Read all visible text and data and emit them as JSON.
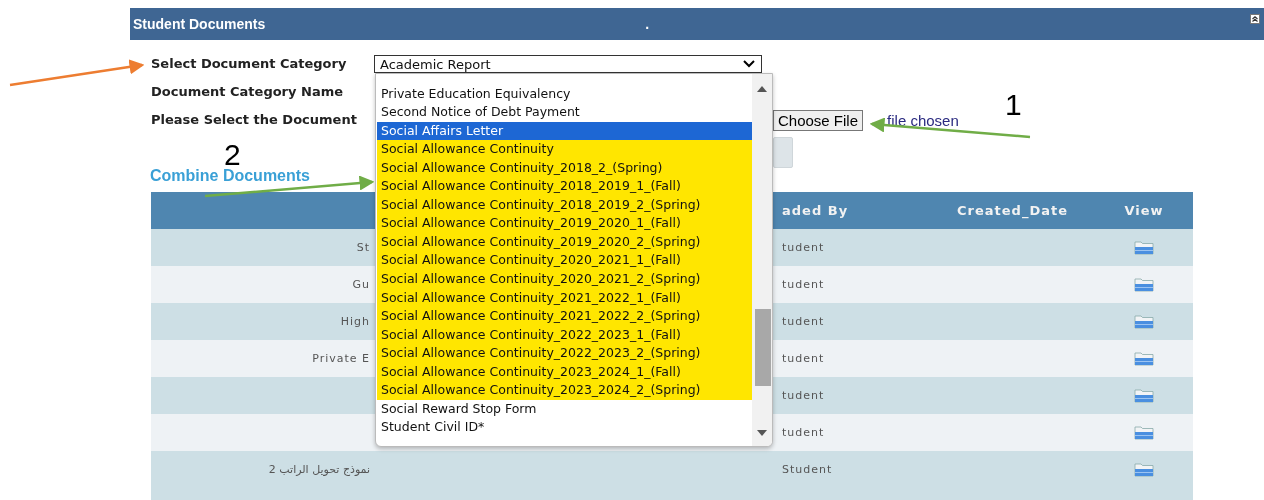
{
  "header": {
    "title": "Student Documents",
    "marker": "."
  },
  "form": {
    "category_label": "Select Document Category",
    "category_value": "Academic Report",
    "name_label": "Document Category Name",
    "document_label": "Please Select the Document",
    "file_button": "Choose File",
    "file_status": "file chosen"
  },
  "dropdown": {
    "options": [
      {
        "label": "Private Education Equivalency",
        "selected": false,
        "highlighted": false
      },
      {
        "label": "Second Notice of Debt Payment",
        "selected": false,
        "highlighted": false
      },
      {
        "label": "Social Affairs Letter",
        "selected": true,
        "highlighted": false
      },
      {
        "label": "Social Allowance Continuity",
        "selected": false,
        "highlighted": true
      },
      {
        "label": "Social Allowance Continuity_2018_2_(Spring)",
        "selected": false,
        "highlighted": true
      },
      {
        "label": "Social Allowance Continuity_2018_2019_1_(Fall)",
        "selected": false,
        "highlighted": true
      },
      {
        "label": "Social Allowance Continuity_2018_2019_2_(Spring)",
        "selected": false,
        "highlighted": true
      },
      {
        "label": "Social Allowance Continuity_2019_2020_1_(Fall)",
        "selected": false,
        "highlighted": true
      },
      {
        "label": "Social Allowance Continuity_2019_2020_2_(Spring)",
        "selected": false,
        "highlighted": true
      },
      {
        "label": "Social Allowance Continuity_2020_2021_1_(Fall)",
        "selected": false,
        "highlighted": true
      },
      {
        "label": "Social Allowance Continuity_2020_2021_2_(Spring)",
        "selected": false,
        "highlighted": true
      },
      {
        "label": "Social Allowance Continuity_2021_2022_1_(Fall)",
        "selected": false,
        "highlighted": true
      },
      {
        "label": "Social Allowance Continuity_2021_2022_2_(Spring)",
        "selected": false,
        "highlighted": true
      },
      {
        "label": "Social Allowance Continuity_2022_2023_1_(Fall)",
        "selected": false,
        "highlighted": true
      },
      {
        "label": "Social Allowance Continuity_2022_2023_2_(Spring)",
        "selected": false,
        "highlighted": true
      },
      {
        "label": "Social Allowance Continuity_2023_2024_1_(Fall)",
        "selected": false,
        "highlighted": true
      },
      {
        "label": "Social Allowance Continuity_2023_2024_2_(Spring)",
        "selected": false,
        "highlighted": true
      },
      {
        "label": "Social Reward Stop Form",
        "selected": false,
        "highlighted": false
      },
      {
        "label": "Student Civil ID*",
        "selected": false,
        "highlighted": false
      }
    ]
  },
  "combine_title": "Combine Documents",
  "table": {
    "columns": [
      "aded By",
      "Created_Date",
      "View"
    ],
    "rows": [
      {
        "column_1": "St",
        "uploaded_by": "tudent"
      },
      {
        "column_1": "Gu",
        "uploaded_by": "tudent"
      },
      {
        "column_1": "High",
        "uploaded_by": "tudent"
      },
      {
        "column_1": "Private E",
        "uploaded_by": "tudent"
      },
      {
        "uploaded_by": "tudent"
      },
      {
        "uploaded_by": "tudent"
      },
      {
        "column_1": "نموذج تحويل الراتب 2",
        "uploaded_by": "Student"
      }
    ]
  },
  "annotation_labels": [
    "1",
    "2"
  ]
}
